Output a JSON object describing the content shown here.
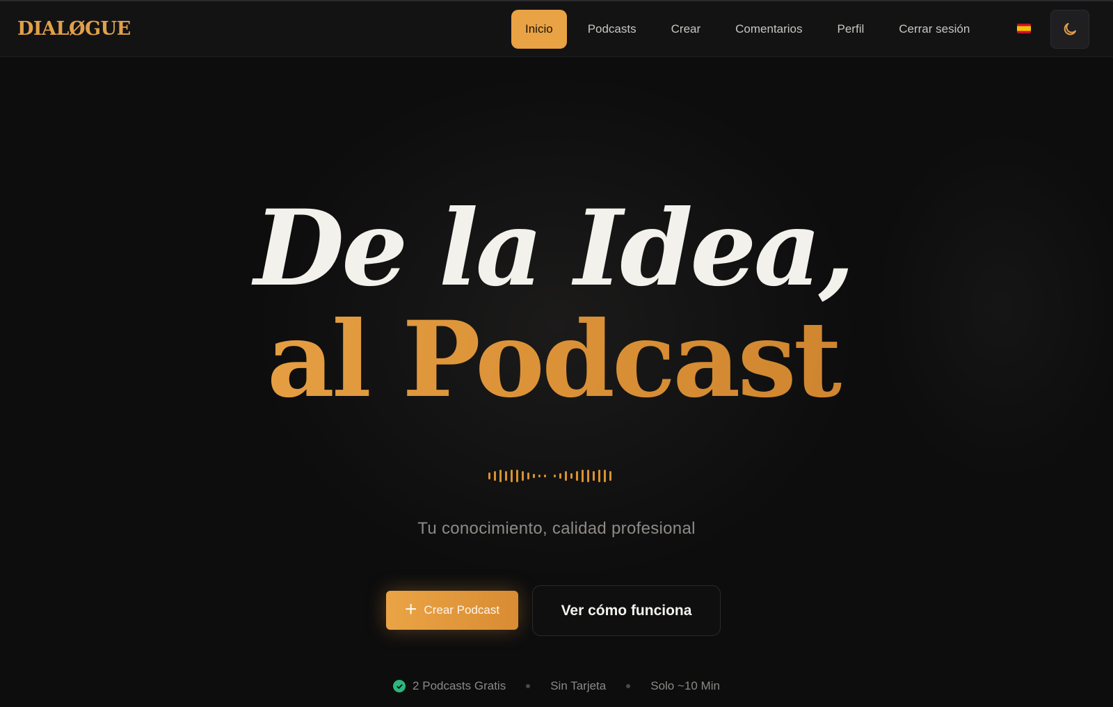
{
  "nav": {
    "logo": "DIALØGUE",
    "links": [
      {
        "label": "Inicio",
        "active": true
      },
      {
        "label": "Podcasts",
        "active": false
      },
      {
        "label": "Crear",
        "active": false
      },
      {
        "label": "Comentarios",
        "active": false
      },
      {
        "label": "Perfil",
        "active": false
      },
      {
        "label": "Cerrar sesión",
        "active": false
      }
    ],
    "language_icon": "spain-flag-icon",
    "theme_icon": "moon-icon"
  },
  "hero": {
    "line1": "De la Idea,",
    "line2": "al Podcast",
    "waveform_icon": "audio-waveform-icon",
    "subtitle": "Tu conocimiento, calidad profesional"
  },
  "cta": {
    "primary_label": "Crear Podcast",
    "primary_icon": "plus-icon",
    "secondary_label": "Ver cómo funciona"
  },
  "features": [
    {
      "label": "2 Podcasts Gratis",
      "icon": "check-circle-icon"
    },
    {
      "label": "Sin Tarjeta"
    },
    {
      "label": "Solo ~10 Min"
    }
  ],
  "colors": {
    "accent": "#e9a244",
    "background": "#0d0d0e",
    "navbar": "#131314",
    "success": "#2bb67f"
  }
}
